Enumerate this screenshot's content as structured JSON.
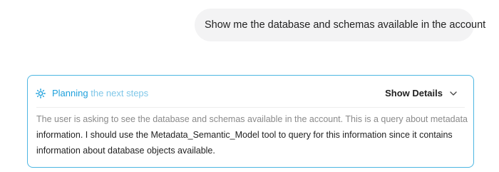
{
  "user_message": "Show me the database and schemas available in the account",
  "card": {
    "title_part1": "Planning",
    "title_part2": " the next steps",
    "toggle_label": "Show Details",
    "body_lines": [
      "The user is asking to see the database and schemas available in the account. This is a query about metadata",
      "information. I should use the Metadata_Semantic_Model tool to query for this information since it contains",
      "information about database objects available."
    ]
  },
  "icons": {
    "planning": "sparkle-icon",
    "toggle": "chevron-down-icon"
  },
  "colors": {
    "accent": "#1ea0dc",
    "card_border": "#4cb6e2",
    "bubble_bg": "#f3f3f4"
  }
}
